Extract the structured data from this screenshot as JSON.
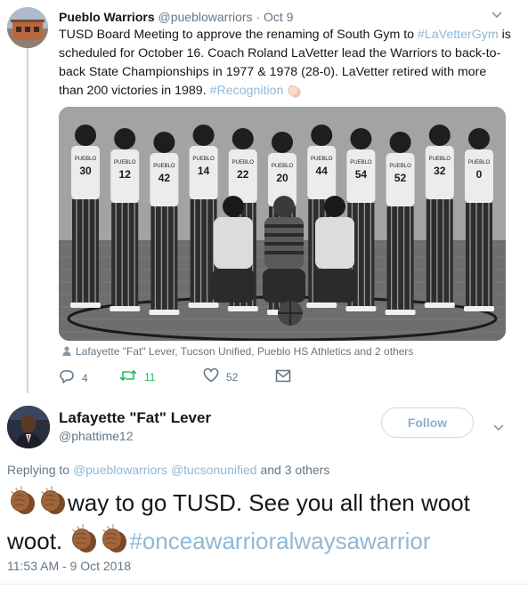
{
  "parent_tweet": {
    "author_name": "Pueblo Warriors",
    "author_handle": "@pueblowarriors",
    "separator": " · ",
    "date": "Oct 9",
    "text_before": "TUSD Board Meeting to approve the renaming of South Gym to ",
    "hashtag_1": "#LaVetterGym",
    "text_middle": " is scheduled for October 16. Coach Roland LaVetter lead the Warriors to back-to-back State Championships in 1977 & 1978 (28-0). LaVetter retired with more than 200 victories in 1989. ",
    "hashtag_2": "#Recognition",
    "photo_tags": "Lafayette \"Fat\" Lever, Tucson Unified, Pueblo HS Athletics and 2 others",
    "actions": {
      "replies": "4",
      "retweets": "11",
      "likes": "52"
    },
    "jerseys": [
      "30",
      "12",
      "42",
      "14",
      "22",
      "20",
      "44",
      "54",
      "52",
      "32",
      "0"
    ],
    "jersey_text": "PUEBLO",
    "icons": [
      "person-icon",
      "reply-icon",
      "retweet-icon",
      "heart-icon",
      "mail-icon",
      "chevron-down-icon"
    ]
  },
  "reply_tweet": {
    "author_name": "Lafayette \"Fat\" Lever",
    "author_handle": "@phattime12",
    "follow_label": "Follow",
    "replying_prefix": "Replying to ",
    "replying_user_1": "@pueblowarriors",
    "replying_user_2": "@tucsonunified",
    "replying_suffix": " and 3 others",
    "text_1": "way to go TUSD. See you all then woot woot. ",
    "hashtag": "#onceawarrioralwaysawarrior",
    "timestamp": "11:53 AM - 9 Oct 2018",
    "emoji": "clapping-hands-medium-dark-skin-tone"
  },
  "colors": {
    "link": "#8fb8d8",
    "retweet": "#17bf63",
    "muted": "#657786",
    "clap": "#a0653a"
  }
}
